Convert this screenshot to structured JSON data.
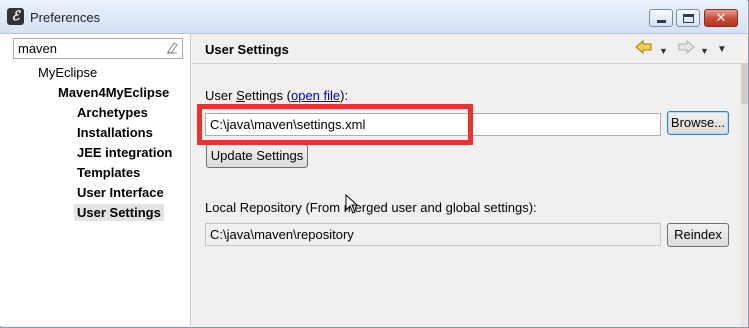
{
  "window": {
    "title": "Preferences",
    "app_icon_glyph": "ℰ",
    "close_glyph": "✕"
  },
  "filter": {
    "value": "maven",
    "clear_icon": "clear-filter-icon"
  },
  "tree": {
    "items": [
      {
        "label": "MyEclipse"
      },
      {
        "label": "Maven4MyEclipse"
      },
      {
        "label": "Archetypes"
      },
      {
        "label": "Installations"
      },
      {
        "label": "JEE integration"
      },
      {
        "label": "Templates"
      },
      {
        "label": "User Interface"
      },
      {
        "label": "User Settings"
      }
    ],
    "selected": "User Settings"
  },
  "page": {
    "title": "User Settings",
    "nav": {
      "back_icon": "back-arrow-icon",
      "forward_icon": "forward-arrow-icon",
      "menu_icon": "view-menu-icon"
    },
    "user_settings": {
      "label_prefix": "User ",
      "label_underlined": "S",
      "label_rest": "ettings (",
      "link_text": "open file",
      "label_suffix": "):",
      "value": "C:\\java\\maven\\settings.xml",
      "browse_button": "Browse...",
      "update_button": "Update Settings"
    },
    "local_repository": {
      "label": "Local Repository (From merged user and global settings):",
      "value": "C:\\java\\maven\\repository",
      "reindex_button": "Reindex"
    }
  },
  "colors": {
    "highlight": "#e8332e",
    "link": "#0000d0",
    "selection": "#e3e3e3"
  }
}
